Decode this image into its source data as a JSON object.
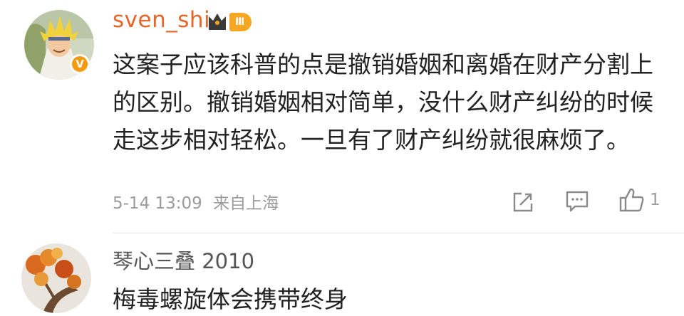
{
  "comments": [
    {
      "username": "sven_shi",
      "verified_badge": "V",
      "level_badge": "Ⅲ",
      "text": "这案子应该科普的点是撤销婚姻和离婚在财产分割上的区别。撤销婚姻相对简单，没什么财产纠纷的时候走这步相对轻松。一旦有了财产纠纷就很麻烦了。",
      "timestamp": "5-14 13:09",
      "location": "来自上海",
      "like_count": "1",
      "icons": [
        "share-icon",
        "comment-icon",
        "like-icon",
        "crown-icon"
      ]
    },
    {
      "username": "琴心三叠 2010",
      "text": "梅毒螺旋体会携带终身"
    }
  ],
  "colors": {
    "username_accent": "#e5652a",
    "badge_orange": "#f5a623",
    "text": "#222222",
    "meta": "#9b9b9b"
  }
}
